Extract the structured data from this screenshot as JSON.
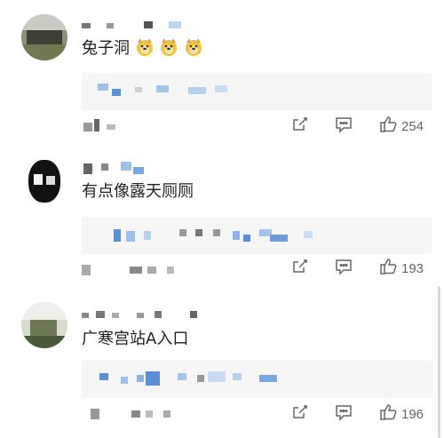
{
  "comments": [
    {
      "text": "兔子洞",
      "emoji_count": 3,
      "emoji_icon": "doge-face-emoji",
      "likes": "254"
    },
    {
      "text": "有点像露天厕厕",
      "emoji_count": 0,
      "likes": "193"
    },
    {
      "text": "广寒宫站A入口",
      "emoji_count": 0,
      "likes": "196"
    }
  ],
  "icons": {
    "share": "share-icon",
    "reply": "comment-icon",
    "like": "thumbs-up-icon"
  },
  "colors": {
    "text": "#1f1f1f",
    "meta": "#666666",
    "reply_bg": "#f6f6f6",
    "blur_blue": "#5b8fd6"
  }
}
